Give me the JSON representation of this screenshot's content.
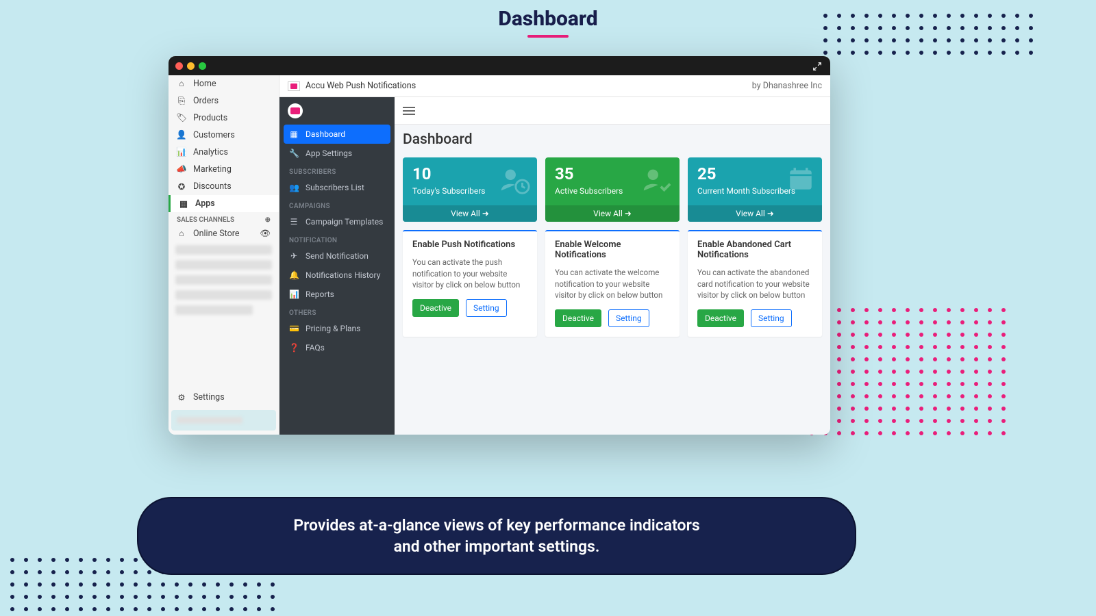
{
  "page_heading": "Dashboard",
  "caption_line1": "Provides at-a-glance views of key performance indicators",
  "caption_line2": "and other important settings.",
  "shop_sidebar": {
    "items": [
      {
        "label": "Home"
      },
      {
        "label": "Orders"
      },
      {
        "label": "Products"
      },
      {
        "label": "Customers"
      },
      {
        "label": "Analytics"
      },
      {
        "label": "Marketing"
      },
      {
        "label": "Discounts"
      },
      {
        "label": "Apps"
      }
    ],
    "sales_channels_label": "SALES CHANNELS",
    "online_store_label": "Online Store",
    "settings_label": "Settings"
  },
  "app_header": {
    "title": "Accu Web Push Notifications",
    "byline": "by Dhanashree Inc"
  },
  "app_nav": {
    "dashboard": "Dashboard",
    "app_settings": "App Settings",
    "section_subscribers": "SUBSCRIBERS",
    "subscribers_list": "Subscribers List",
    "section_campaigns": "CAMPAIGNS",
    "campaign_templates": "Campaign Templates",
    "section_notification": "NOTIFICATION",
    "send_notification": "Send Notification",
    "notifications_history": "Notifications History",
    "reports": "Reports",
    "section_others": "OTHERS",
    "pricing": "Pricing & Plans",
    "faqs": "FAQs"
  },
  "dashboard": {
    "title": "Dashboard",
    "stats": [
      {
        "value": "10",
        "label": "Today's Subscribers",
        "view_all": "View All"
      },
      {
        "value": "35",
        "label": "Active Subscribers",
        "view_all": "View All"
      },
      {
        "value": "25",
        "label": "Current Month Subscribers",
        "view_all": "View All"
      }
    ],
    "cards": [
      {
        "title": "Enable Push Notifications",
        "body": "You can activate the push notification to your website visitor by click on below button",
        "deactive": "Deactive",
        "setting": "Setting"
      },
      {
        "title": "Enable Welcome Notifications",
        "body": "You can activate the welcome notification to your website visitor by click on below button",
        "deactive": "Deactive",
        "setting": "Setting"
      },
      {
        "title": "Enable Abandoned Cart Notifications",
        "body": "You can activate the abandoned card notification to your website visitor by click on below button",
        "deactive": "Deactive",
        "setting": "Setting"
      }
    ]
  }
}
